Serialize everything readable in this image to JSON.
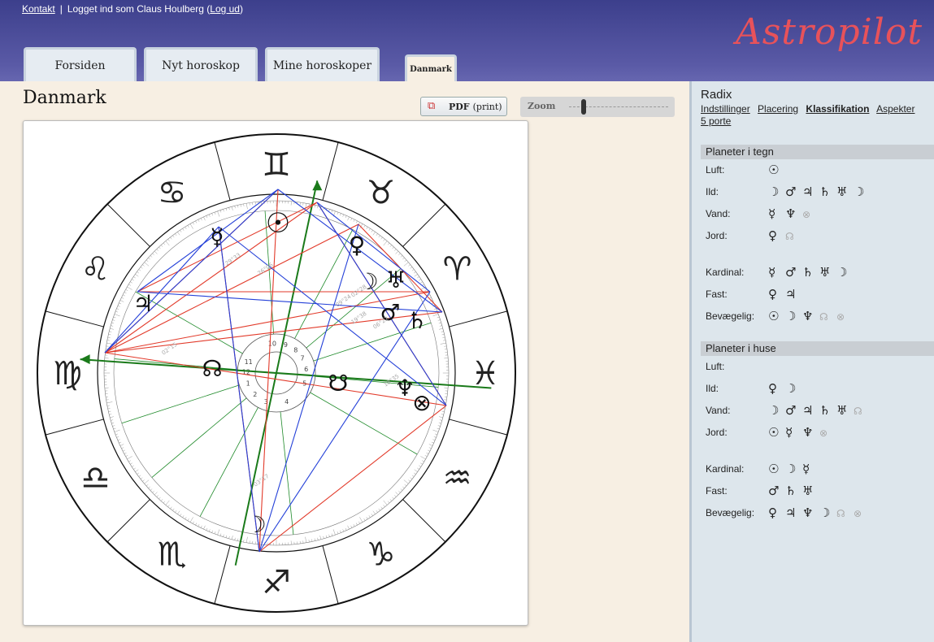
{
  "header": {
    "contact_link": "Kontakt",
    "logged_in_text": "Logget ind som Claus Houlberg",
    "logout_link": "Log ud",
    "logo": "Astropilot",
    "tabs": [
      "Forsiden",
      "Nyt horoskop",
      "Mine horoskoper",
      "Danmark"
    ]
  },
  "main": {
    "title": "Danmark",
    "pdf_bold": "PDF",
    "pdf_label": "(print)",
    "zoom_label": "Zoom"
  },
  "chart": {
    "signs": [
      "♊",
      "♉",
      "♈",
      "♓",
      "♒",
      "♑",
      "♐",
      "♏",
      "♎",
      "♍",
      "♌",
      "♋"
    ],
    "planets": [
      "☉",
      "☿",
      "♀",
      "☽",
      "♅",
      "♂",
      "♄",
      "♃",
      "☊",
      "☋",
      "♆",
      "⊗",
      "☽"
    ],
    "house_numbers": [
      "10",
      "9",
      "8",
      "7",
      "6",
      "5",
      "4",
      "3",
      "2",
      "1",
      "12",
      "11"
    ],
    "degree_labels": [
      "09°24",
      "02°28",
      "06°22",
      "19°38",
      "02°15",
      "18°35",
      "26°06",
      "03°17",
      "29°33"
    ],
    "colors": {
      "red": "#e23a2a",
      "blue": "#2440d8",
      "green": "#1f8a2a",
      "axis_green": "#1a7a1a"
    }
  },
  "sidebar": {
    "title": "Radix",
    "links": [
      "Indstillinger",
      "Placering",
      "Klassifikation",
      "Aspekter",
      "5 porte"
    ],
    "active_link": "Klassifikation",
    "sections": [
      {
        "title": "Planeter i tegn",
        "rows": [
          {
            "label": "Luft:",
            "symbols": [
              "☉"
            ]
          },
          {
            "label": "Ild:",
            "symbols": [
              "☽",
              "♂",
              "♃",
              "♄",
              "♅",
              "☽"
            ]
          },
          {
            "label": "Vand:",
            "symbols": [
              "☿",
              "♆"
            ],
            "dim": [
              "⊗"
            ]
          },
          {
            "label": "Jord:",
            "symbols": [
              "♀"
            ],
            "dim": [
              "☊"
            ]
          },
          {
            "label": "Kardinal:",
            "symbols": [
              "☿",
              "♂",
              "♄",
              "♅",
              "☽"
            ]
          },
          {
            "label": "Fast:",
            "symbols": [
              "♀",
              "♃"
            ]
          },
          {
            "label": "Bevægelig:",
            "symbols": [
              "☉",
              "☽",
              "♆"
            ],
            "dim": [
              "☊",
              "⊗"
            ]
          }
        ]
      },
      {
        "title": "Planeter i huse",
        "rows": [
          {
            "label": "Luft:",
            "symbols": []
          },
          {
            "label": "Ild:",
            "symbols": [
              "♀",
              "☽"
            ]
          },
          {
            "label": "Vand:",
            "symbols": [
              "☽",
              "♂",
              "♃",
              "♄",
              "♅"
            ],
            "dim": [
              "☊"
            ]
          },
          {
            "label": "Jord:",
            "symbols": [
              "☉",
              "☿",
              "♆"
            ],
            "dim": [
              "⊗"
            ]
          },
          {
            "label": "Kardinal:",
            "symbols": [
              "☉",
              "☽",
              "☿"
            ]
          },
          {
            "label": "Fast:",
            "symbols": [
              "♂",
              "♄",
              "♅"
            ]
          },
          {
            "label": "Bevægelig:",
            "symbols": [
              "♀",
              "♃",
              "♆",
              "☽"
            ],
            "dim": [
              "☊",
              "⊗"
            ]
          }
        ]
      }
    ]
  }
}
